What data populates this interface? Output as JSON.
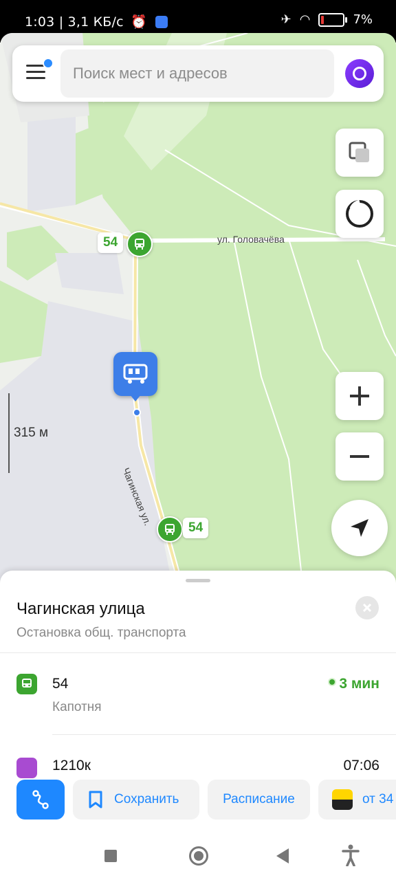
{
  "status_bar": {
    "left_text": "1:03 | 3,1 КБ/с",
    "battery": "7%"
  },
  "search": {
    "placeholder": "Поиск мест и адресов"
  },
  "map": {
    "street_top": "ул. Головачёва",
    "street_main": "Чагинская ул.",
    "route_label_top": "54",
    "route_label_bottom": "54",
    "scale": "315 м"
  },
  "sheet": {
    "title": "Чагинская улица",
    "subtitle": "Остановка общ. транспорта",
    "routes": [
      {
        "number": "54",
        "destination": "Капотня",
        "time": "3 мин",
        "color": "#3ca530"
      },
      {
        "number": "1210к",
        "destination": "",
        "time": "07:06",
        "color": "#a84bd1"
      }
    ]
  },
  "actions": {
    "save": "Сохранить",
    "schedule": "Расписание",
    "taxi": "от 34"
  },
  "colors": {
    "accent": "#1e88ff",
    "bus_green": "#3ca530",
    "stop_blue": "#3d7ee8"
  }
}
